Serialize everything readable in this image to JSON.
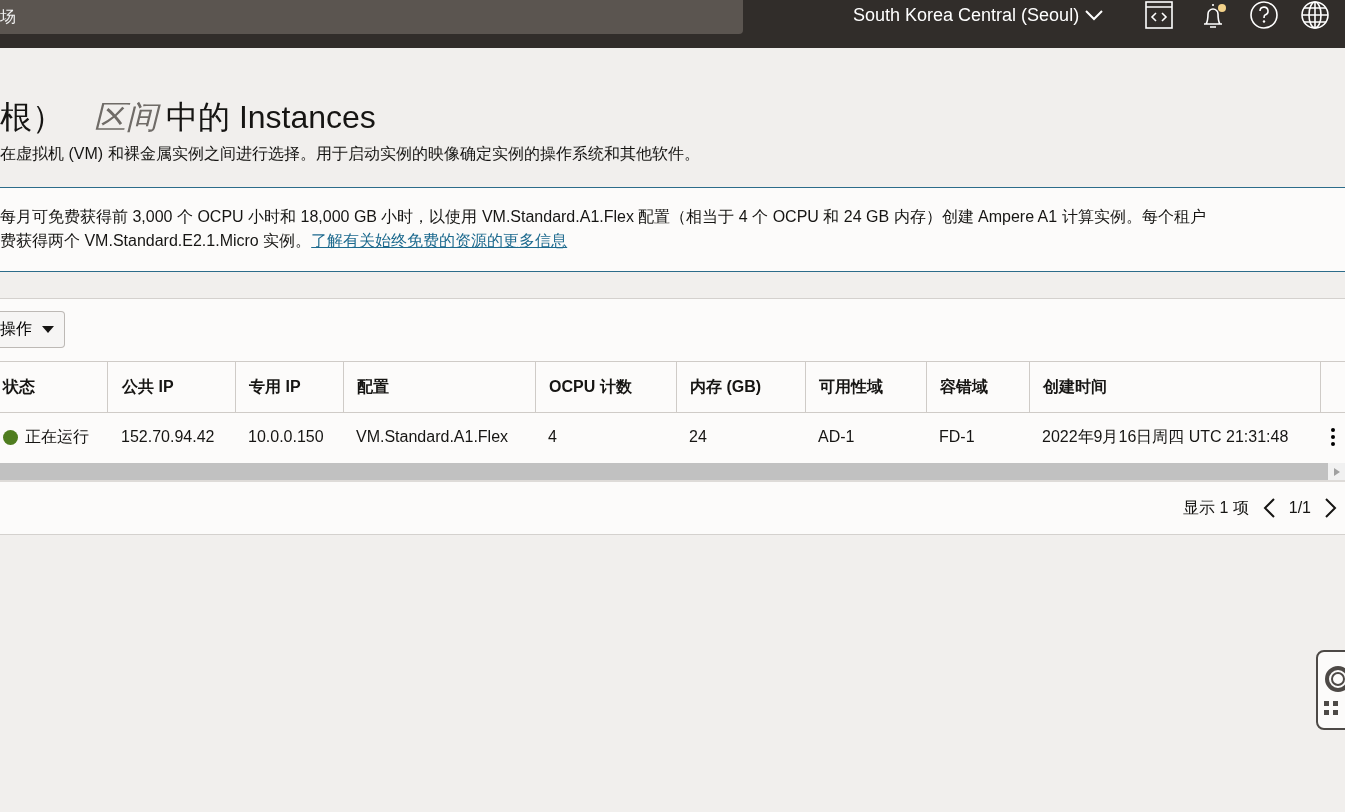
{
  "header": {
    "search": {
      "placeholder": "场"
    },
    "region": "South Korea Central (Seoul)",
    "notification_dot": true
  },
  "title": {
    "prefix": "根）",
    "compartment": "区间",
    "suffix": "中的 Instances"
  },
  "description": "在虚拟机 (VM) 和裸金属实例之间进行选择。用于启动实例的映像确定实例的操作系统和其他软件。",
  "info": {
    "line_1": "每月可免费获得前 3,000 个 OCPU 小时和 18,000 GB 小时，以使用 VM.Standard.A1.Flex 配置（相当于 4 个 OCPU 和 24 GB 内存）创建 Ampere A1 计算实例。每个租户",
    "line_2": "费获得两个 VM.Standard.E2.1.Micro 实例。",
    "link": "了解有关始终免费的资源的更多信息"
  },
  "actions_button": "操作",
  "table": {
    "columns": [
      "状态",
      "公共 IP",
      "专用 IP",
      "配置",
      "OCPU 计数",
      "内存 (GB)",
      "可用性域",
      "容错域",
      "创建时间"
    ],
    "rows": [
      {
        "color": "#4f7d1f",
        "cells": [
          "正在运行",
          "152.70.94.42",
          "10.0.0.150",
          "VM.Standard.A1.Flex",
          "4",
          "24",
          "AD-1",
          "FD-1",
          "2022年9月16日周四 UTC 21:31:48"
        ]
      }
    ]
  },
  "footer": {
    "count": "显示 1 项",
    "page": "1/1"
  }
}
